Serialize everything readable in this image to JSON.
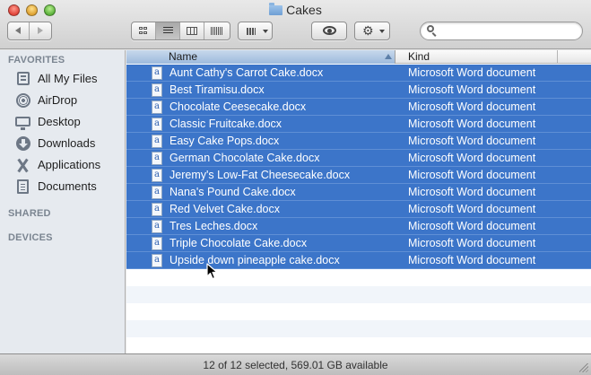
{
  "window": {
    "title": "Cakes",
    "traffic_lights": {
      "close": "#e0443a",
      "minimize": "#dea232",
      "zoom": "#5bb13b"
    }
  },
  "toolbar": {
    "back_icon": "chevron-left-icon",
    "forward_icon": "chevron-right-icon",
    "view_modes": [
      "icon",
      "list",
      "columns",
      "cover-flow"
    ],
    "active_view": "list",
    "arrange_icon": "arrange-grid-icon",
    "quicklook_icon": "eye-icon",
    "action_icon": "gear-icon",
    "action_glyph": "⚙",
    "search": {
      "value": "",
      "placeholder": ""
    }
  },
  "sidebar": {
    "sections": {
      "favorites": "FAVORITES",
      "shared": "SHARED",
      "devices": "DEVICES"
    },
    "items": [
      {
        "label": "All My Files",
        "icon": "all-files-icon"
      },
      {
        "label": "AirDrop",
        "icon": "airdrop-icon"
      },
      {
        "label": "Desktop",
        "icon": "desktop-icon"
      },
      {
        "label": "Downloads",
        "icon": "downloads-icon"
      },
      {
        "label": "Applications",
        "icon": "applications-icon"
      },
      {
        "label": "Documents",
        "icon": "documents-icon"
      }
    ]
  },
  "file_list": {
    "columns": {
      "name": "Name",
      "kind": "Kind"
    },
    "sort_column": "name",
    "sort_direction": "ascending",
    "selection_color": "#3c75c9",
    "files": [
      {
        "name": "Aunt Cathy's Carrot Cake.docx",
        "kind": "Microsoft Word document",
        "selected": true
      },
      {
        "name": "Best Tiramisu.docx",
        "kind": "Microsoft Word document",
        "selected": true
      },
      {
        "name": "Chocolate Ceesecake.docx",
        "kind": "Microsoft Word document",
        "selected": true
      },
      {
        "name": "Classic Fruitcake.docx",
        "kind": "Microsoft Word document",
        "selected": true
      },
      {
        "name": "Easy Cake Pops.docx",
        "kind": "Microsoft Word document",
        "selected": true
      },
      {
        "name": "German Chocolate Cake.docx",
        "kind": "Microsoft Word document",
        "selected": true
      },
      {
        "name": "Jeremy's Low-Fat Cheesecake.docx",
        "kind": "Microsoft Word document",
        "selected": true
      },
      {
        "name": "Nana's Pound Cake.docx",
        "kind": "Microsoft Word document",
        "selected": true
      },
      {
        "name": "Red Velvet Cake.docx",
        "kind": "Microsoft Word document",
        "selected": true
      },
      {
        "name": "Tres Leches.docx",
        "kind": "Microsoft Word document",
        "selected": true
      },
      {
        "name": "Triple Chocolate Cake.docx",
        "kind": "Microsoft Word document",
        "selected": true
      },
      {
        "name": "Upside down pineapple cake.docx",
        "kind": "Microsoft Word document",
        "selected": true
      }
    ]
  },
  "status_bar": {
    "text": "12 of 12 selected, 569.01 GB available"
  }
}
